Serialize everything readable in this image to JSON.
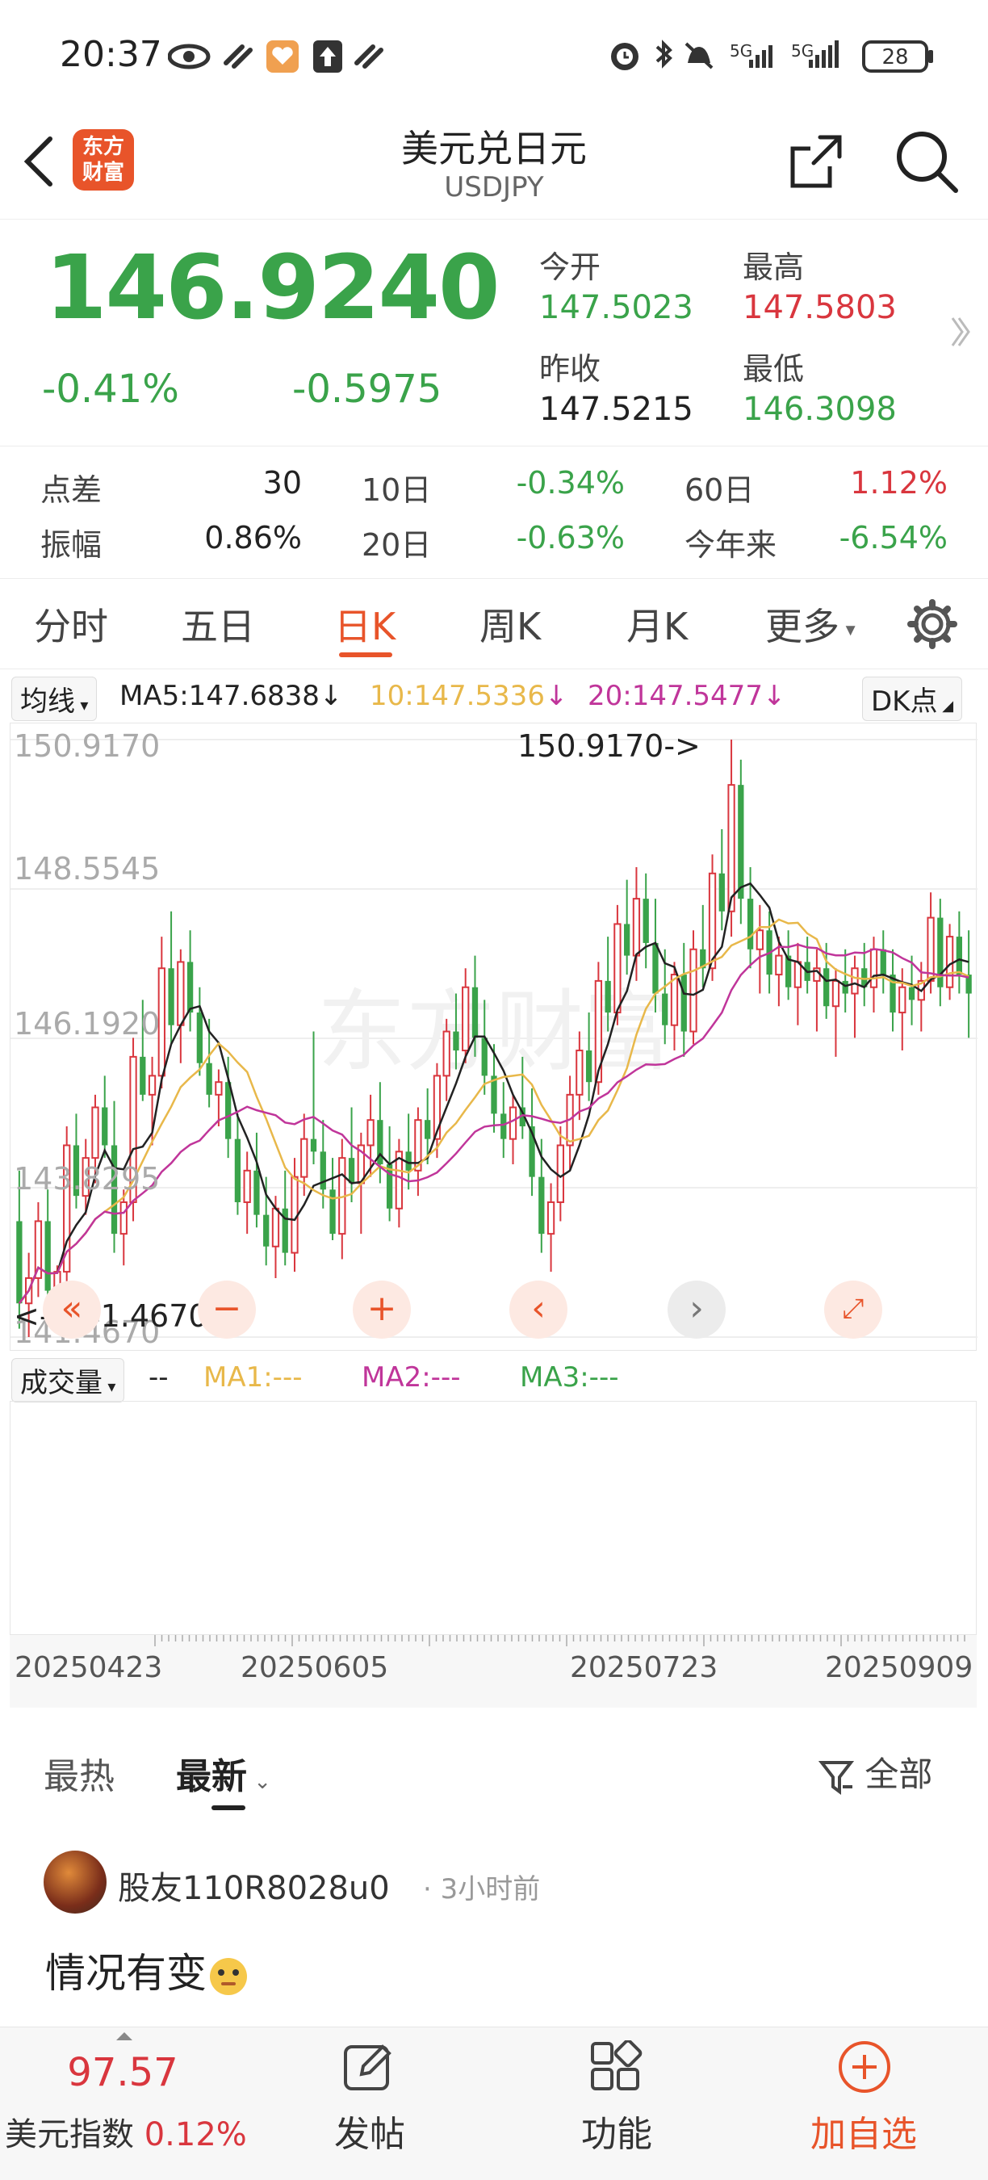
{
  "status_bar": {
    "time": "20:37",
    "battery": "28",
    "signal1": "5G",
    "signal2": "5G"
  },
  "nav": {
    "title": "美元兑日元",
    "subtitle": "USDJPY",
    "logo_text_1": "东方",
    "logo_text_2": "财富"
  },
  "quote": {
    "price": "146.9240",
    "change_pct": "-0.41%",
    "change": "-0.5975",
    "open_label": "今开",
    "open": "147.5023",
    "high_label": "最高",
    "high": "147.5803",
    "prev_close_label": "昨收",
    "prev_close": "147.5215",
    "low_label": "最低",
    "low": "146.3098"
  },
  "stats": {
    "spread_label": "点差",
    "spread": "30",
    "d10_label": "10日",
    "d10": "-0.34%",
    "d60_label": "60日",
    "d60": "1.12%",
    "amp_label": "振幅",
    "amp": "0.86%",
    "d20_label": "20日",
    "d20": "-0.63%",
    "ytd_label": "今年来",
    "ytd": "-6.54%"
  },
  "tabs": [
    "分时",
    "五日",
    "日K",
    "周K",
    "月K",
    "更多"
  ],
  "active_tab": "日K",
  "ma_bar": {
    "selector": "均线",
    "ma5": "MA5:147.6838",
    "ma10": "10:147.5336",
    "ma20": "20:147.5477",
    "dk": "DK点"
  },
  "chart_labels": {
    "y_top": "150.9170",
    "y2": "148.5545",
    "y3": "146.1920",
    "y4": "143.8295",
    "y_bottom": "141.4670",
    "max_annot": "150.9170->",
    "min_annot": "<--141.4670"
  },
  "volume_bar": {
    "selector": "成交量",
    "dash": "--",
    "ma1": "MA1:---",
    "ma2": "MA2:---",
    "ma3": "MA3:---"
  },
  "x_axis": [
    "20250423",
    "20250605",
    "20250723",
    "20250909"
  ],
  "colors": {
    "up": "#d9363e",
    "down": "#3aa34a",
    "ma5": "#222222",
    "ma10": "#e8b84a",
    "ma20": "#c0359a",
    "accent": "#e8542a"
  },
  "chart_data": {
    "type": "candlestick",
    "y_range": [
      141.467,
      150.917
    ],
    "ma": {
      "MA5": 147.6838,
      "MA10": 147.5336,
      "MA20": 147.5477
    },
    "max": 150.917,
    "min": 141.467,
    "ohlc": [
      [
        143.3,
        144.1,
        141.6,
        142.0
      ],
      [
        142.0,
        142.8,
        141.467,
        142.4
      ],
      [
        142.4,
        143.6,
        142.1,
        143.3
      ],
      [
        143.3,
        143.8,
        142.0,
        142.2
      ],
      [
        142.2,
        142.6,
        141.7,
        142.5
      ],
      [
        142.5,
        144.8,
        142.3,
        144.5
      ],
      [
        144.5,
        145.0,
        143.5,
        143.7
      ],
      [
        143.7,
        144.6,
        143.4,
        144.3
      ],
      [
        144.3,
        145.3,
        143.9,
        145.1
      ],
      [
        145.1,
        145.6,
        144.3,
        144.5
      ],
      [
        144.5,
        145.2,
        142.8,
        143.1
      ],
      [
        143.1,
        143.8,
        142.6,
        143.6
      ],
      [
        143.6,
        146.2,
        143.3,
        145.9
      ],
      [
        145.9,
        146.8,
        145.2,
        145.3
      ],
      [
        145.3,
        145.9,
        144.5,
        145.6
      ],
      [
        145.6,
        147.8,
        145.4,
        147.3
      ],
      [
        147.3,
        148.2,
        146.1,
        146.4
      ],
      [
        146.4,
        147.6,
        145.8,
        147.4
      ],
      [
        147.4,
        147.9,
        146.3,
        146.6
      ],
      [
        146.6,
        147.0,
        145.6,
        145.8
      ],
      [
        145.8,
        146.5,
        145.1,
        145.3
      ],
      [
        145.3,
        145.7,
        144.8,
        145.5
      ],
      [
        145.5,
        145.9,
        144.3,
        144.6
      ],
      [
        144.6,
        145.0,
        143.4,
        143.6
      ],
      [
        143.6,
        144.4,
        143.1,
        144.1
      ],
      [
        144.1,
        144.7,
        143.2,
        143.4
      ],
      [
        143.4,
        144.0,
        142.6,
        142.9
      ],
      [
        142.9,
        143.7,
        142.4,
        143.5
      ],
      [
        143.5,
        144.1,
        142.6,
        142.8
      ],
      [
        142.8,
        144.3,
        142.5,
        144.0
      ],
      [
        144.0,
        145.0,
        143.7,
        144.6
      ],
      [
        144.6,
        146.3,
        144.2,
        144.4
      ],
      [
        144.4,
        144.9,
        143.5,
        143.8
      ],
      [
        143.8,
        144.3,
        143.0,
        143.1
      ],
      [
        143.1,
        144.6,
        142.7,
        144.3
      ],
      [
        144.3,
        145.1,
        143.6,
        143.9
      ],
      [
        143.9,
        144.7,
        143.1,
        144.5
      ],
      [
        144.5,
        145.3,
        144.0,
        144.9
      ],
      [
        144.9,
        145.5,
        143.9,
        144.2
      ],
      [
        144.2,
        144.8,
        143.3,
        143.5
      ],
      [
        143.5,
        144.6,
        143.2,
        144.4
      ],
      [
        144.4,
        145.0,
        143.8,
        144.1
      ],
      [
        144.1,
        145.1,
        143.7,
        144.9
      ],
      [
        144.9,
        145.4,
        144.2,
        144.6
      ],
      [
        144.6,
        145.8,
        144.3,
        145.6
      ],
      [
        145.6,
        146.5,
        145.2,
        146.3
      ],
      [
        146.3,
        146.9,
        145.7,
        146.0
      ],
      [
        146.0,
        147.3,
        145.8,
        147.0
      ],
      [
        147.0,
        147.5,
        145.9,
        146.2
      ],
      [
        146.2,
        146.8,
        145.3,
        145.6
      ],
      [
        145.6,
        146.1,
        144.7,
        145.0
      ],
      [
        145.0,
        145.5,
        144.3,
        144.6
      ],
      [
        144.6,
        145.3,
        144.2,
        145.1
      ],
      [
        145.1,
        145.9,
        144.6,
        144.8
      ],
      [
        144.8,
        145.4,
        143.7,
        144.0
      ],
      [
        144.0,
        144.6,
        142.8,
        143.1
      ],
      [
        143.1,
        143.9,
        142.5,
        143.6
      ],
      [
        143.6,
        144.8,
        143.3,
        144.5
      ],
      [
        144.5,
        145.6,
        144.1,
        145.3
      ],
      [
        145.3,
        146.3,
        144.9,
        146.0
      ],
      [
        146.0,
        146.6,
        145.2,
        145.5
      ],
      [
        145.5,
        147.4,
        145.3,
        147.1
      ],
      [
        147.1,
        147.8,
        146.3,
        146.6
      ],
      [
        146.6,
        148.3,
        146.4,
        148.0
      ],
      [
        148.0,
        148.7,
        147.2,
        147.5
      ],
      [
        147.5,
        148.9,
        147.1,
        148.4
      ],
      [
        148.4,
        148.8,
        147.3,
        147.7
      ],
      [
        147.7,
        148.4,
        146.6,
        146.9
      ],
      [
        146.9,
        147.6,
        146.1,
        146.4
      ],
      [
        146.4,
        147.4,
        146.0,
        147.2
      ],
      [
        147.2,
        147.7,
        145.9,
        146.3
      ],
      [
        146.3,
        147.9,
        146.1,
        147.6
      ],
      [
        147.6,
        148.3,
        147.0,
        147.3
      ],
      [
        147.3,
        149.1,
        147.1,
        148.8
      ],
      [
        148.8,
        149.5,
        147.9,
        148.2
      ],
      [
        148.2,
        150.917,
        147.8,
        150.2
      ],
      [
        150.2,
        150.6,
        148.0,
        148.4
      ],
      [
        148.4,
        148.9,
        147.3,
        147.6
      ],
      [
        147.6,
        148.3,
        146.9,
        147.9
      ],
      [
        147.9,
        148.2,
        146.9,
        147.2
      ],
      [
        147.2,
        147.8,
        146.7,
        147.5
      ],
      [
        147.5,
        147.9,
        146.8,
        147.0
      ],
      [
        147.0,
        147.7,
        146.4,
        147.4
      ],
      [
        147.4,
        147.8,
        146.9,
        147.1
      ],
      [
        147.1,
        147.6,
        146.3,
        147.3
      ],
      [
        147.3,
        147.7,
        146.5,
        146.7
      ],
      [
        146.7,
        147.3,
        145.9,
        147.1
      ],
      [
        147.1,
        147.6,
        146.6,
        146.9
      ],
      [
        146.9,
        147.5,
        146.2,
        147.3
      ],
      [
        147.3,
        147.7,
        146.7,
        147.0
      ],
      [
        147.0,
        147.8,
        146.6,
        147.6
      ],
      [
        147.6,
        147.9,
        146.9,
        147.2
      ],
      [
        147.2,
        147.6,
        146.3,
        146.6
      ],
      [
        146.6,
        147.3,
        146.0,
        147.0
      ],
      [
        147.0,
        147.5,
        146.4,
        146.8
      ],
      [
        146.8,
        147.4,
        146.3,
        147.1
      ],
      [
        147.1,
        148.5,
        146.9,
        148.1
      ],
      [
        148.1,
        148.4,
        146.7,
        147.0
      ],
      [
        147.0,
        148.0,
        146.8,
        147.8
      ],
      [
        147.8,
        148.2,
        146.9,
        147.2
      ],
      [
        147.2,
        147.9,
        146.2,
        146.9
      ]
    ],
    "x_ticks": [
      "20250423",
      "20250605",
      "20250723",
      "20250909"
    ]
  },
  "comments": {
    "tab_hot": "最热",
    "tab_new": "最新",
    "filter": "全部",
    "items": [
      {
        "user": "股友110R8028u0",
        "time": "3小时前",
        "text": "情况有变"
      }
    ]
  },
  "bottom_bar": {
    "index_value": "97.57",
    "index_name": "美元指数",
    "index_change": "0.12%",
    "post": "发帖",
    "func": "功能",
    "add": "加自选"
  }
}
